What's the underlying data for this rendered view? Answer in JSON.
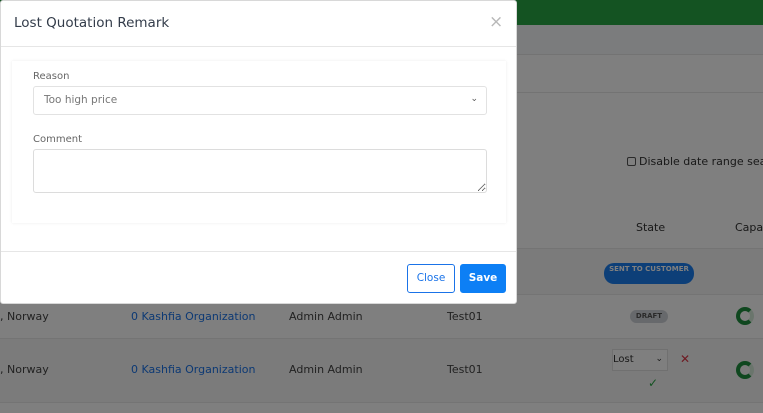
{
  "background": {
    "filter_label": "Disable date range search",
    "table_headers": {
      "state": "State",
      "capacity": "Capa"
    },
    "rows": [
      {
        "state_badge": "SENT TO CUSTOMER"
      },
      {
        "location": ", Norway",
        "organization": "0 Kashfia Organization",
        "user": "Admin Admin",
        "name": "Test01",
        "state_badge": "DRAFT"
      },
      {
        "location": ", Norway",
        "organization": "0 Kashfia Organization",
        "user": "Admin Admin",
        "name": "Test01",
        "state_select": "Lost"
      }
    ],
    "colors": {
      "topbar": "#28a745",
      "link": "#1a73e8",
      "badge_sent": "#1a7ff0",
      "badge_draft": "#cfd3d8"
    }
  },
  "modal": {
    "title": "Lost Quotation Remark",
    "close_icon": "close-icon",
    "reason_label": "Reason",
    "reason_value": "Too high price",
    "comment_label": "Comment",
    "comment_value": "",
    "close_button": "Close",
    "save_button": "Save",
    "colors": {
      "primary": "#0d7ff5"
    }
  }
}
